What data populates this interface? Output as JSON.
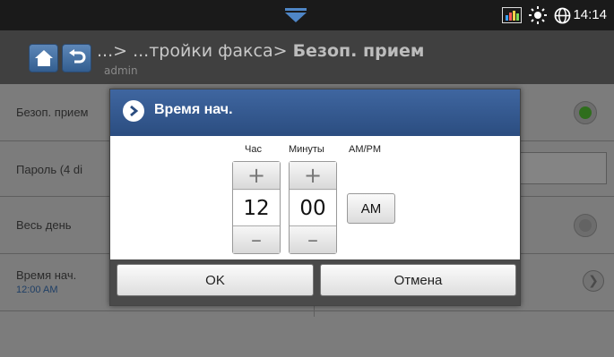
{
  "status_bar": {
    "time": "14:14",
    "icons": [
      "pulldown-arrow-icon",
      "signal-bars-icon",
      "brightness-icon",
      "globe-icon"
    ]
  },
  "header": {
    "breadcrumb_prefix": "...> ...тройки факса> ",
    "breadcrumb_current": "Безоп. прием",
    "user": "admin",
    "buttons": [
      "home-icon",
      "back-icon"
    ]
  },
  "list": {
    "rows": [
      {
        "label": "Безоп. прием",
        "radio": "on"
      },
      {
        "label": "Пароль (4 di"
      },
      {
        "label": "Весь день",
        "radio": "off"
      },
      {
        "label": "Время нач.",
        "value": "12:00 AM"
      }
    ]
  },
  "dialog": {
    "title": "Время нач.",
    "hour_label": "Час",
    "minutes_label": "Минуты",
    "ampm_label": "AM/PM",
    "hour_value": "12",
    "minutes_value": "00",
    "ampm_value": "AM",
    "plus": "+",
    "minus": "–",
    "ok_label": "OK",
    "cancel_label": "Отмена"
  },
  "colors": {
    "title_bar": "#2f5488",
    "radio_on": "#2f6e1d"
  }
}
